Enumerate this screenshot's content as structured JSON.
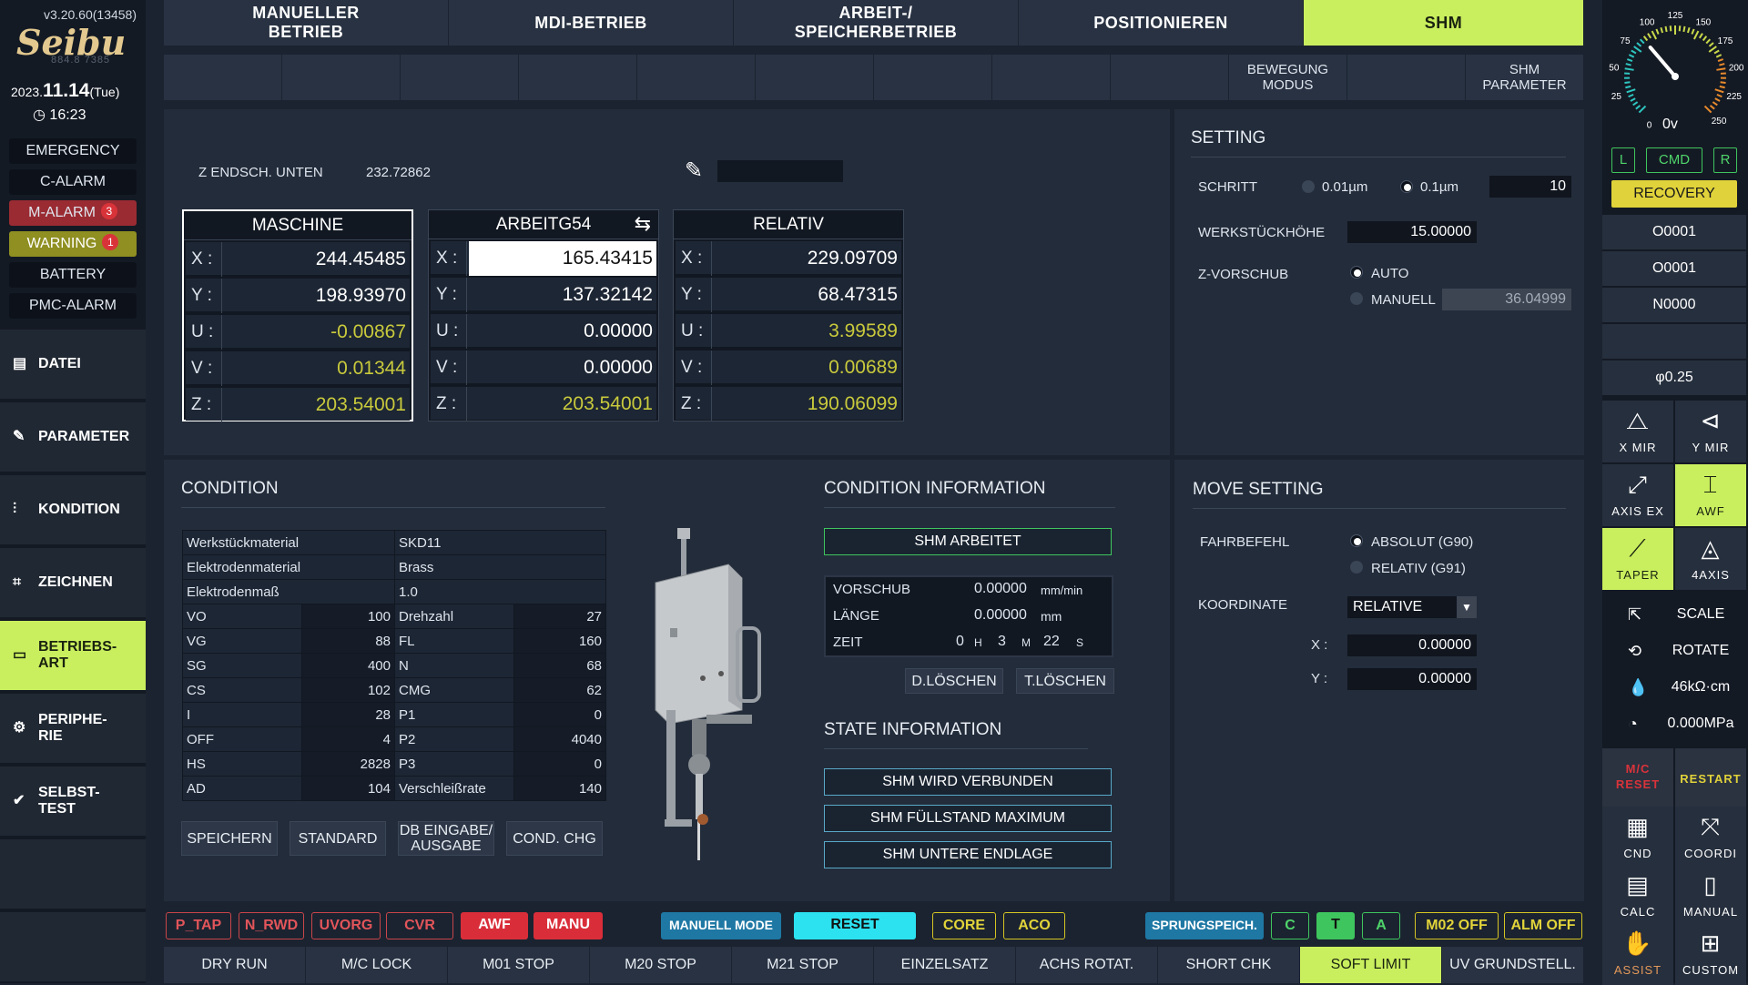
{
  "version": "v3.20.60(13458)",
  "logo": "Seibu",
  "logo_sub": "884.8   7385",
  "date_year": "2023.",
  "date_md": "11.14",
  "date_dow": "(Tue)",
  "time": "16:23",
  "alarms": [
    {
      "label": "EMERGENCY",
      "count": ""
    },
    {
      "label": "C-ALARM",
      "count": ""
    },
    {
      "label": "M-ALARM",
      "count": "3"
    },
    {
      "label": "WARNING",
      "count": "1"
    },
    {
      "label": "BATTERY",
      "count": ""
    },
    {
      "label": "PMC-ALARM",
      "count": ""
    }
  ],
  "nav": [
    {
      "label": "DATEI",
      "icon": "file-icon"
    },
    {
      "label": "PARAMETER",
      "icon": "wrench-icon"
    },
    {
      "label": "KONDITION",
      "icon": "sliders-icon"
    },
    {
      "label": "ZEICHNEN",
      "icon": "draw-icon"
    },
    {
      "label": "BETRIEBS-\nART",
      "icon": "monitor-icon"
    },
    {
      "label": "PERIPHE-\nRIE",
      "icon": "gear-icon"
    },
    {
      "label": "SELBST-\nTEST",
      "icon": "check-icon"
    }
  ],
  "top_tabs": [
    "MANUELLER\nBETRIEB",
    "MDI-BETRIEB",
    "ARBEIT-/\nSPEICHERBETRIEB",
    "POSITIONIEREN",
    "SHM"
  ],
  "sub_buttons": [
    "",
    "",
    "",
    "",
    "",
    "",
    "",
    "",
    "",
    "BEWEGUNG\nMODUS",
    "",
    "SHM\nPARAMETER"
  ],
  "z_end_label": "Z ENDSCH. UNTEN",
  "z_end_value": "232.72862",
  "coords": [
    {
      "title": "MASCHINE",
      "rows": [
        [
          "X :",
          "244.45485"
        ],
        [
          "Y :",
          "198.93970"
        ],
        [
          "U :",
          "-0.00867"
        ],
        [
          "V :",
          "0.01344"
        ],
        [
          "Z :",
          "203.54001"
        ]
      ]
    },
    {
      "title": "ARBEITG54",
      "rows": [
        [
          "X :",
          "165.43415"
        ],
        [
          "Y :",
          "137.32142"
        ],
        [
          "U :",
          "0.00000"
        ],
        [
          "V :",
          "0.00000"
        ],
        [
          "Z :",
          "203.54001"
        ]
      ]
    },
    {
      "title": "RELATIV",
      "rows": [
        [
          "X :",
          "229.09709"
        ],
        [
          "Y :",
          "68.47315"
        ],
        [
          "U :",
          "3.99589"
        ],
        [
          "V :",
          "0.00689"
        ],
        [
          "Z :",
          "190.06099"
        ]
      ]
    }
  ],
  "setting": {
    "title": "SETTING",
    "schritt_label": "SCHRITT",
    "schritt_opt1": "0.01µm",
    "schritt_opt2": "0.1µm",
    "schritt_value": "10",
    "werkstueck_label": "WERKSTÜCKHÖHE",
    "werkstueck_value": "15.00000",
    "zvor_label": "Z-VORSCHUB",
    "zvor_auto": "AUTO",
    "zvor_manuell": "MANUELL",
    "zvor_value": "36.04999"
  },
  "condition": {
    "title": "CONDITION",
    "rows3": [
      [
        "Werkstückmaterial",
        "SKD11"
      ],
      [
        "Elektrodenmaterial",
        "Brass"
      ],
      [
        "Elektrodenmaß",
        "1.0"
      ]
    ],
    "rows4": [
      [
        "VO",
        "100",
        "Drehzahl",
        "27"
      ],
      [
        "VG",
        "88",
        "FL",
        "160"
      ],
      [
        "SG",
        "400",
        "N",
        "68"
      ],
      [
        "CS",
        "102",
        "CMG",
        "62"
      ],
      [
        "I",
        "28",
        "P1",
        "0"
      ],
      [
        "OFF",
        "4",
        "P2",
        "4040"
      ],
      [
        "HS",
        "2828",
        "P3",
        "0"
      ],
      [
        "AD",
        "104",
        "Verschleißrate",
        "140"
      ]
    ],
    "buttons": [
      "SPEICHERN",
      "STANDARD",
      "DB EINGABE/\nAUSGABE",
      "COND. CHG"
    ]
  },
  "cond_info": {
    "title": "CONDITION INFORMATION",
    "status": "SHM ARBEITET",
    "rows": [
      {
        "label": "VORSCHUB",
        "value": "0.00000",
        "unit": "mm/min"
      },
      {
        "label": "LÄNGE",
        "value": "0.00000",
        "unit": "mm"
      }
    ],
    "zeit_label": "ZEIT",
    "zeit_h": "0",
    "zeit_hu": "H",
    "zeit_m": "3",
    "zeit_mu": "M",
    "zeit_s": "22",
    "zeit_su": "S",
    "btn_d": "D.LÖSCHEN",
    "btn_t": "T.LÖSCHEN"
  },
  "state_info": {
    "title": "STATE INFORMATION",
    "items": [
      "SHM WIRD VERBUNDEN",
      "SHM FÜLLSTAND MAXIMUM",
      "SHM UNTERE ENDLAGE"
    ]
  },
  "move_setting": {
    "title": "MOVE SETTING",
    "fahr_label": "FAHRBEFEHL",
    "fahr_abs": "ABSOLUT (G90)",
    "fahr_rel": "RELATIV (G91)",
    "koord_label": "KOORDINATE",
    "koord_value": "RELATIVE",
    "x_label": "X :",
    "x_value": "0.00000",
    "y_label": "Y :",
    "y_value": "0.00000"
  },
  "status_bar": [
    "P_TAP",
    "N_RWD",
    "UVORG",
    "CVR",
    "AWF",
    "MANU",
    "MANUELL MODE",
    "RESET",
    "CORE",
    "ACO",
    "SPRUNGSPEICH.",
    "C",
    "T",
    "A",
    "M02 OFF",
    "ALM OFF"
  ],
  "func_tabs": [
    "DRY RUN",
    "M/C LOCK",
    "M01 STOP",
    "M20 STOP",
    "M21 STOP",
    "EINZELSATZ",
    "ACHS ROTAT.",
    "SHORT CHK",
    "SOFT LIMIT",
    "UV GRUNDSTELL."
  ],
  "gauge": {
    "ticks": [
      "25",
      "50",
      "75",
      "100",
      "125",
      "150",
      "175",
      "200",
      "225",
      "250",
      "0"
    ],
    "readout": "0v",
    "value": 0.35
  },
  "lcr": [
    "L",
    "CMD",
    "R"
  ],
  "recovery": "RECOVERY",
  "program": [
    "O0001",
    "O0001",
    "N0000",
    "",
    "φ0.25"
  ],
  "grid1": [
    "X MIR",
    "Y MIR",
    "AXIS EX",
    "AWF",
    "TAPER",
    "4AXIS"
  ],
  "side_rows": [
    {
      "icon": "scale-icon",
      "label": "SCALE"
    },
    {
      "icon": "rotate-icon",
      "label": "ROTATE"
    },
    {
      "icon": "water-drop-icon",
      "label": "46kΩ·cm"
    },
    {
      "icon": "pressure-gauge-icon",
      "label": "0.000MPa"
    }
  ],
  "grid2": [
    "M/C\nRESET",
    "RESTART",
    "CND",
    "COORDI",
    "CALC",
    "MANUAL",
    "ASSIST",
    "CUSTOM"
  ]
}
